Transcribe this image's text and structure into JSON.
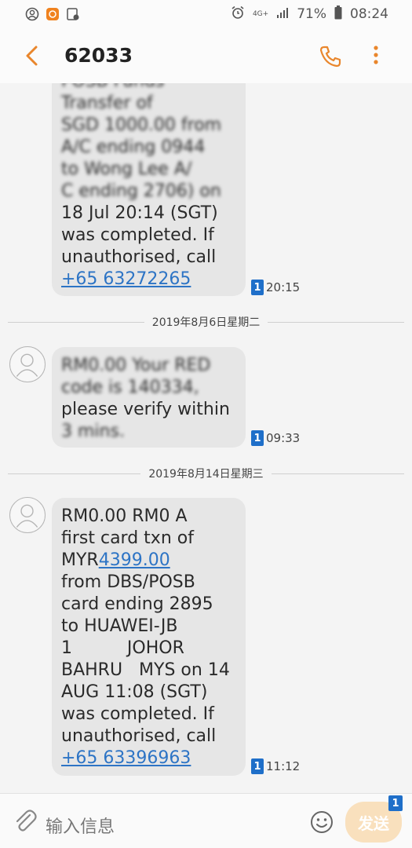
{
  "status_bar": {
    "battery": "71%",
    "time": "08:24",
    "network": "4G+",
    "icons": [
      "account-circle-icon",
      "notification-app-icon",
      "screen-record-icon",
      "alarm-icon",
      "signal-icon",
      "battery-icon"
    ]
  },
  "app_bar": {
    "title": "62033",
    "back_icon": "chevron-left-icon",
    "call_icon": "phone-icon",
    "more_icon": "more-vertical-icon",
    "accent": "#e9862c"
  },
  "messages": [
    {
      "lines": [
        "POSB Funds",
        "Transfer of",
        "SGD 1000.00 from",
        "A/C ending 0944",
        "to Wong Lee A/",
        "C ending 2706) on",
        "18 Jul 20:14 (SGT)",
        "was completed. If",
        "unauthorised, call"
      ],
      "phone": "+65 63272265",
      "sim": "1",
      "time": "20:15"
    },
    {
      "date": "2019年8月6日星期二",
      "lines": [
        "RM0.00 Your RED",
        "code is 140334,",
        "please verify within",
        "3 mins."
      ],
      "sim": "1",
      "time": "09:33"
    },
    {
      "date": "2019年8月14日星期三",
      "lines": [
        "RM0.00 RM0 A",
        "first card txn of",
        "MYR",
        "from DBS/POSB",
        "card ending 2895",
        "to HUAWEI-JB",
        "1          JOHOR",
        "BAHRU   MYS on 14",
        "AUG 11:08 (SGT)",
        "was completed. If",
        "unauthorised, call"
      ],
      "amount": "4399.00",
      "phone": "+65 63396963",
      "sim": "1",
      "time": "11:12"
    }
  ],
  "composer": {
    "placeholder": "输入信息",
    "send_label": "发送",
    "send_badge": "1",
    "attach_icon": "paperclip-icon",
    "emoji_icon": "smiley-icon"
  }
}
